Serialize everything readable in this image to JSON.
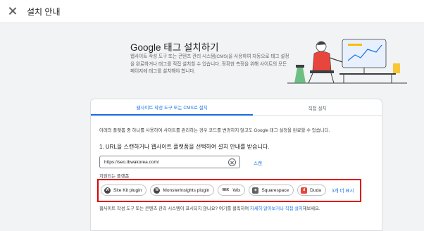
{
  "header": {
    "title": "설치 안내",
    "close_icon": "close-icon"
  },
  "intro": {
    "title": "Google 태그 설치하기",
    "description": "웹사이트 작성 도구 또는 콘텐츠 관리 시스템(CMS)을 사용하여 자동으로 태그 설정을 완료하거나 태그를 직접 설치할 수 있습니다. 정확한 측정을 위해 사이트의 모든 페이지에 태그를 설치해야 합니다."
  },
  "tabs": [
    {
      "label": "웹사이트 작성 도구 또는 CMS로 설치",
      "active": true
    },
    {
      "label": "직접 설치",
      "active": false
    }
  ],
  "main": {
    "instruction": "아래의 플랫폼 중 하나를 사용하여 사이트를 관리하는 경우 코드를 변경하지 않고도 Google 태그 설정을 완료할 수 있습니다.",
    "step": "1. URL을 스캔하거나 웹사이트 플랫폼을 선택하여 설치 안내를 받습니다.",
    "url_value": "https://seo.tbwakorea.com/",
    "scan_label": "스캔",
    "platform_label": "지원되는 플랫폼",
    "platforms": [
      {
        "label": "Site Kit plugin",
        "icon": "wordpress-icon"
      },
      {
        "label": "MonsterInsights plugin",
        "icon": "wordpress-icon"
      },
      {
        "label": "Wix",
        "icon": "wix-icon"
      },
      {
        "label": "Squarespace",
        "icon": "squarespace-icon"
      },
      {
        "label": "Duda",
        "icon": "duda-icon"
      }
    ],
    "more_label": "3개 더 표시",
    "footer_prefix": "웹사이트 작성 도구 또는 콘텐츠 관리 시스템이 표시되지 않나요? 여기를 클릭하여 ",
    "footer_link1": "자세히 알아보거나",
    "footer_link2": "직접 설치",
    "footer_suffix": "해보세요."
  },
  "colors": {
    "accent": "#1a73e8",
    "highlight": "#e00000"
  }
}
